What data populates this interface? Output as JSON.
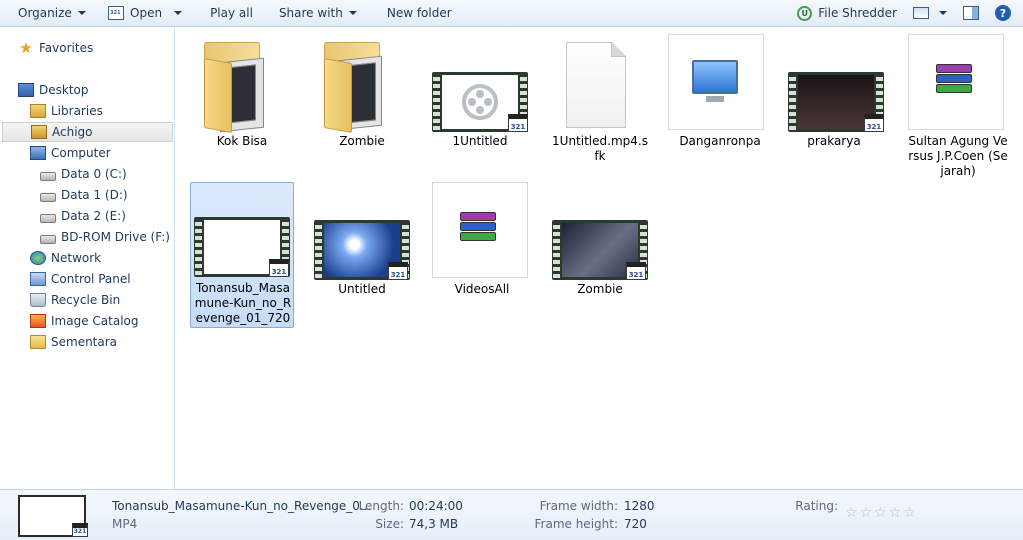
{
  "toolbar": {
    "organize": "Organize",
    "open": "Open",
    "play_all": "Play all",
    "share_with": "Share with",
    "new_folder": "New folder",
    "file_shredder": "File Shredder"
  },
  "sidebar": {
    "favorites": "Favorites",
    "items": [
      {
        "label": "Desktop",
        "icon": "desktop-icon"
      },
      {
        "label": "Libraries",
        "icon": "libraries-icon"
      },
      {
        "label": "Achigo",
        "icon": "user-folder-icon"
      },
      {
        "label": "Computer",
        "icon": "computer-icon"
      },
      {
        "label": "Data 0 (C:)",
        "icon": "drive-icon"
      },
      {
        "label": "Data 1 (D:)",
        "icon": "drive-icon"
      },
      {
        "label": "Data 2 (E:)",
        "icon": "drive-icon"
      },
      {
        "label": "BD-ROM Drive (F:)",
        "icon": "optical-drive-icon"
      },
      {
        "label": "Network",
        "icon": "network-icon"
      },
      {
        "label": "Control Panel",
        "icon": "control-panel-icon"
      },
      {
        "label": "Recycle Bin",
        "icon": "recycle-bin-icon"
      },
      {
        "label": "Image Catalog",
        "icon": "image-catalog-icon"
      },
      {
        "label": "Sementara",
        "icon": "folder-icon"
      }
    ],
    "selected": "Achigo"
  },
  "files": [
    {
      "name": "Kok Bisa",
      "kind": "folder"
    },
    {
      "name": "Zombie",
      "kind": "folder"
    },
    {
      "name": "1Untitled",
      "kind": "video"
    },
    {
      "name": "1Untitled.mp4.sfk",
      "kind": "document"
    },
    {
      "name": "Danganronpa",
      "kind": "shortcut"
    },
    {
      "name": "prakarya",
      "kind": "video"
    },
    {
      "name": "Sultan Agung Versus J.P.Coen (Sejarah)",
      "kind": "archive"
    },
    {
      "name": "Tonansub_Masamune-Kun_no_Revenge_01_720",
      "kind": "video",
      "selected": true
    },
    {
      "name": "Untitled",
      "kind": "video"
    },
    {
      "name": "VideosAll",
      "kind": "archive"
    },
    {
      "name": "Zombie",
      "kind": "video"
    }
  ],
  "badge_text": "321",
  "details": {
    "name": "Tonansub_Masamune-Kun_no_Revenge_0...",
    "type": "MP4",
    "length_label": "Length:",
    "length": "00:24:00",
    "size_label": "Size:",
    "size": "74,3 MB",
    "frame_width_label": "Frame width:",
    "frame_width": "1280",
    "frame_height_label": "Frame height:",
    "frame_height": "720",
    "rating_label": "Rating:",
    "rating": 0,
    "rating_max": 5
  },
  "colors": {
    "toolbar_text": "#1e395b",
    "selection_bg": "#cfe1f8",
    "selection_border": "#84acdd"
  }
}
